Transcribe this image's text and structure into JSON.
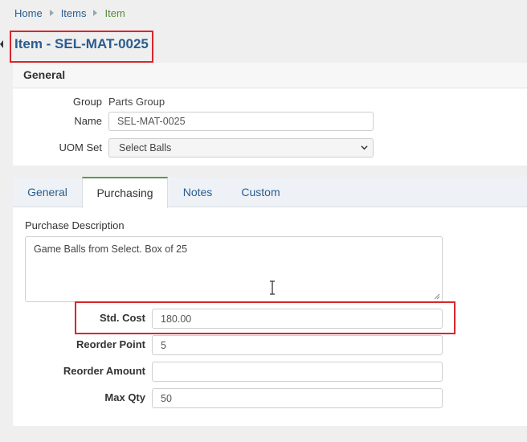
{
  "breadcrumb": {
    "home": "Home",
    "items": "Items",
    "current": "Item"
  },
  "page": {
    "title": "Item - SEL-MAT-0025"
  },
  "general_panel": {
    "header": "General",
    "group_label": "Group",
    "group_value": "Parts Group",
    "name_label": "Name",
    "name_value": "SEL-MAT-0025",
    "uom_label": "UOM Set",
    "uom_value": "Select Balls"
  },
  "tabs": [
    {
      "label": "General",
      "active": false
    },
    {
      "label": "Purchasing",
      "active": true
    },
    {
      "label": "Notes",
      "active": false
    },
    {
      "label": "Custom",
      "active": false
    }
  ],
  "purchasing": {
    "description_label": "Purchase Description",
    "description_value": "Game Balls from Select. Box of 25",
    "std_cost_label": "Std. Cost",
    "std_cost_value": "180.00",
    "reorder_point_label": "Reorder Point",
    "reorder_point_value": "5",
    "reorder_amount_label": "Reorder Amount",
    "reorder_amount_value": "",
    "max_qty_label": "Max Qty",
    "max_qty_value": "50"
  },
  "colors": {
    "link": "#2a5d8f",
    "current": "#5a8a3c",
    "highlight": "#d9262b",
    "active_tab": "#5a9a4a"
  },
  "icons": [
    "chevron-right-icon",
    "chevron-down-icon",
    "text-cursor-icon",
    "resize-handle-icon"
  ]
}
